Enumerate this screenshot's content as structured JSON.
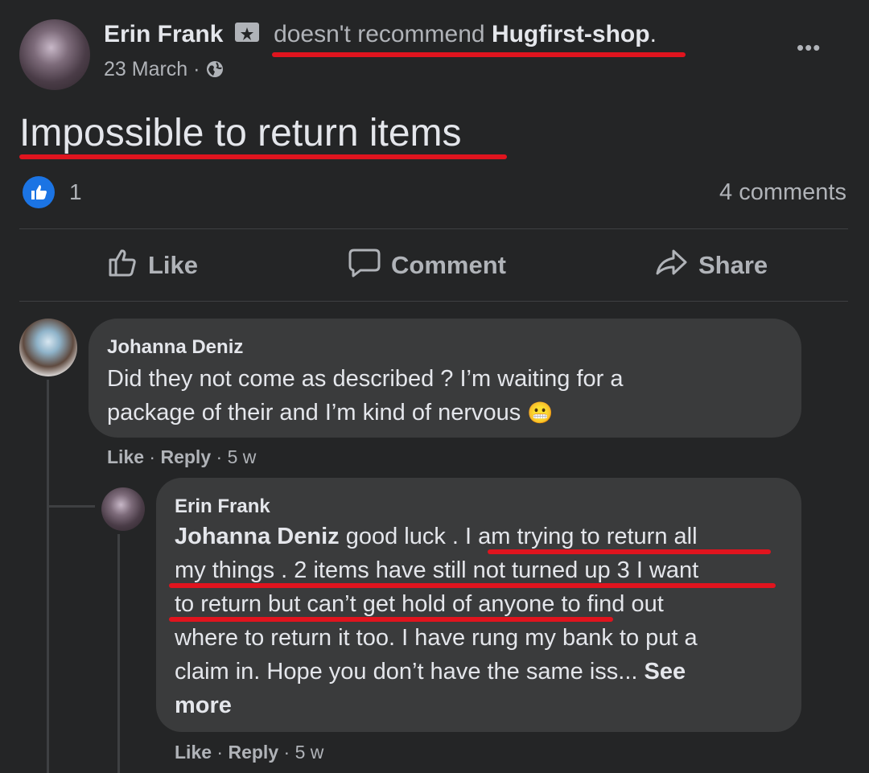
{
  "post": {
    "author": "Erin Frank",
    "verb": "doesn't recommend",
    "target": "Hugfirst-shop",
    "date": "23 March",
    "menu": "•••",
    "title": "Impossible to return items",
    "like_count": "1",
    "comments_count": "4 comments"
  },
  "actions": {
    "like": "Like",
    "comment": "Comment",
    "share": "Share"
  },
  "comments": [
    {
      "author": "Johanna Deniz",
      "text_line1": "Did they not come as described ? I’m waiting for a",
      "text_line2": "package of their and I’m kind of nervous",
      "emoji": "😬",
      "like": "Like",
      "reply": "Reply",
      "age": "5 w"
    },
    {
      "author": "Erin Frank",
      "mention": "Johanna Deniz",
      "line1": " good luck . I am trying to return all",
      "line2": "my things . 2 items have still not turned up 3 I want",
      "line3": "to return but can’t get hold of anyone to find out",
      "line4": "where to return it too. I have rung my bank to put a",
      "line5": "claim in. Hope you don’t have the same iss... ",
      "see": "See",
      "more": "more",
      "like": "Like",
      "reply": "Reply",
      "age": "5 w"
    }
  ],
  "colors": {
    "background": "#242526",
    "bubble": "#3a3b3c",
    "text": "#e4e6eb",
    "muted": "#b0b3b8",
    "highlight": "#e0141e",
    "like_blue": "#1b74e4"
  }
}
